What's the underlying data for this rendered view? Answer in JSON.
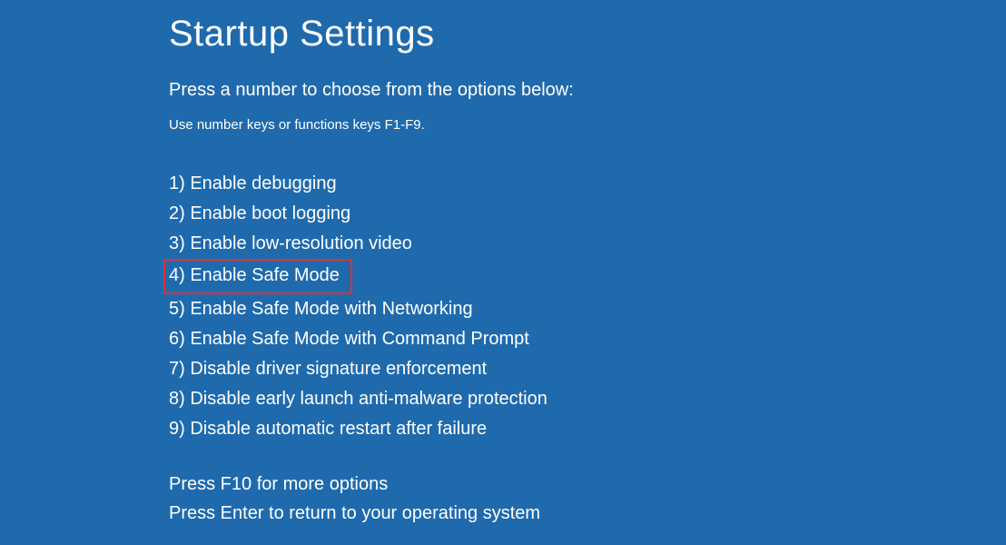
{
  "title": "Startup Settings",
  "instruction": "Press a number to choose from the options below:",
  "hint": "Use number keys or functions keys F1-F9.",
  "options": [
    {
      "num": "1",
      "label": "Enable debugging",
      "highlighted": false
    },
    {
      "num": "2",
      "label": "Enable boot logging",
      "highlighted": false
    },
    {
      "num": "3",
      "label": "Enable low-resolution video",
      "highlighted": false
    },
    {
      "num": "4",
      "label": "Enable Safe Mode",
      "highlighted": true
    },
    {
      "num": "5",
      "label": "Enable Safe Mode with Networking",
      "highlighted": false
    },
    {
      "num": "6",
      "label": "Enable Safe Mode with Command Prompt",
      "highlighted": false
    },
    {
      "num": "7",
      "label": "Disable driver signature enforcement",
      "highlighted": false
    },
    {
      "num": "8",
      "label": "Disable early launch anti-malware protection",
      "highlighted": false
    },
    {
      "num": "9",
      "label": "Disable automatic restart after failure",
      "highlighted": false
    }
  ],
  "footer": {
    "more": "Press F10 for more options",
    "return": "Press Enter to return to your operating system"
  }
}
